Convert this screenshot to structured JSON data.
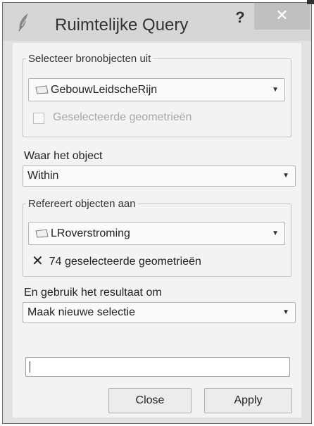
{
  "window": {
    "title": "Ruimtelijke Query",
    "help_label": "?",
    "close_label": "✕"
  },
  "source_group": {
    "title": "Selecteer bronobjecten uit",
    "layer": "GebouwLeidscheRijn",
    "checkbox_label": "Geselecteerde geometrieën",
    "checkbox_checked": false
  },
  "where": {
    "label": "Waar het object",
    "value": "Within"
  },
  "reference_group": {
    "title": "Refereert objecten aan",
    "layer": "LRoverstroming",
    "status_text": "74 geselecteerde geometrieën"
  },
  "result": {
    "label": "En gebruik het resultaat om",
    "value": "Maak nieuwe selectie"
  },
  "input": {
    "value": ""
  },
  "buttons": {
    "close_label": "Close",
    "apply_label": "Apply"
  },
  "icons": {
    "app": "qgis-feather-icon",
    "layer": "polygon-layer-icon",
    "dropdown": "dropdown-arrow-icon",
    "status": "x-mark-icon"
  }
}
